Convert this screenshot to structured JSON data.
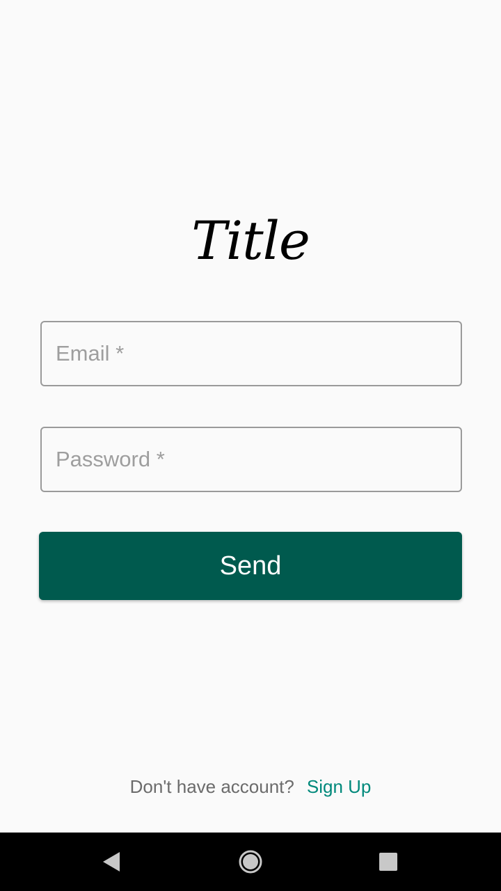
{
  "app": {
    "title": "Title"
  },
  "form": {
    "email": {
      "placeholder": "Email *",
      "value": ""
    },
    "password": {
      "placeholder": "Password *",
      "value": ""
    },
    "send_label": "Send"
  },
  "footer": {
    "prompt": "Don't have account?",
    "signup_label": "Sign Up"
  },
  "navbar": {
    "back_icon": "back-triangle-icon",
    "home_icon": "home-circle-icon",
    "recents_icon": "recents-square-icon"
  },
  "colors": {
    "background": "#fafafa",
    "primary": "#005a4e",
    "link": "#00897b",
    "field_border": "#9a9a9a",
    "placeholder": "#9e9e9e"
  }
}
